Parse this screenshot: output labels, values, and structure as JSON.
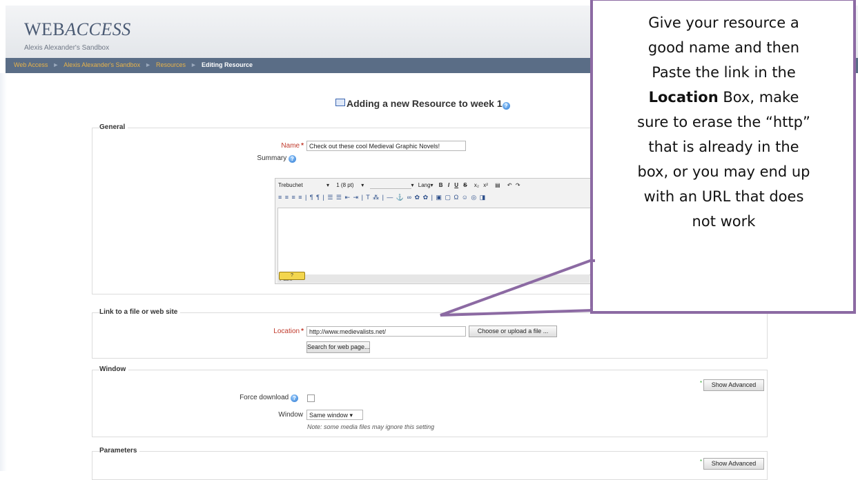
{
  "app": {
    "logo_main": "WEB",
    "logo_italic": "ACCESS",
    "sandbox": "Alexis Alexander's Sandbox"
  },
  "breadcrumb": {
    "items": [
      "Web Access",
      "Alexis Alexander's Sandbox",
      "Resources"
    ],
    "current": "Editing Resource"
  },
  "page": {
    "title": "Adding a new Resource to week 1"
  },
  "general": {
    "legend": "General",
    "name_label": "Name",
    "name_value": "Check out these cool Medieval Graphic Novels!",
    "summary_label": "Summary",
    "editor": {
      "font": "Trebuchet",
      "size": "1 (8 pt)",
      "lang": "Lang",
      "toolbar_row2": "≡ ≡ ≡ ≡ | ¶ ¶ | ☰ ☰ ⇤ ⇥ | T ⁂ | — ⚓ ∞ ✿ ✿ | ▣ ▢ Ω ☺ ◎ ◨",
      "path_label": "Path:"
    }
  },
  "link": {
    "legend": "Link to a file or web site",
    "location_label": "Location",
    "location_value": "http://www.medievalists.net/",
    "choose_button": "Choose or upload a file ...",
    "search_button": "Search for web page..."
  },
  "window_section": {
    "legend": "Window",
    "show_advanced": "Show Advanced",
    "force_download_label": "Force download",
    "window_label": "Window",
    "window_value": "Same window",
    "note": "Note: some media files may ignore this setting"
  },
  "parameters": {
    "legend": "Parameters",
    "show_advanced": "Show Advanced"
  },
  "callout": {
    "line1": "Give your resource a",
    "line2": "good name and then",
    "line3": "Paste the link in the",
    "line4_bold": "Location",
    "line4_rest": " Box, make",
    "line5": "sure to erase the “http”",
    "line6": "that is already in the",
    "line7": "box, or you may end up",
    "line8": "with an URL that does",
    "line9": "not work"
  },
  "colors": {
    "navbar": "#5a6d86",
    "crumb_link": "#e8b34a",
    "required": "#c0392b",
    "callout_border": "#8c6aa3"
  }
}
